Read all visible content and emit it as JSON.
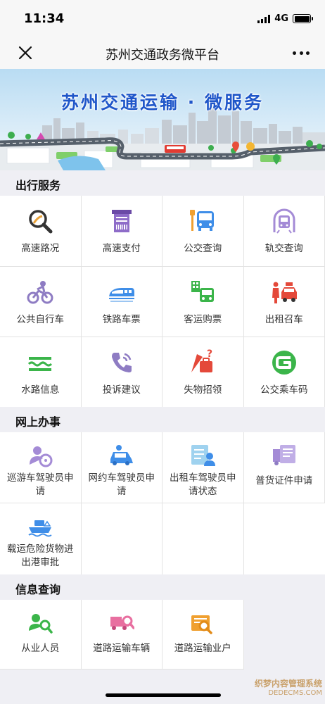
{
  "status_bar": {
    "time": "11:34",
    "network": "4G",
    "battery_level": 1.0
  },
  "nav": {
    "title": "苏州交通政务微平台",
    "close_icon": "close-icon",
    "more_icon": "more-icon"
  },
  "banner": {
    "title": "苏州交通运输 · 微服务"
  },
  "sections": [
    {
      "title": "出行服务",
      "items": [
        {
          "label": "高速路况",
          "icon": "highway-search-icon"
        },
        {
          "label": "高速支付",
          "icon": "toll-receipt-icon"
        },
        {
          "label": "公交查询",
          "icon": "bus-stop-icon"
        },
        {
          "label": "轨交查询",
          "icon": "metro-icon"
        },
        {
          "label": "公共自行车",
          "icon": "bicycle-icon"
        },
        {
          "label": "铁路车票",
          "icon": "train-icon"
        },
        {
          "label": "客运购票",
          "icon": "coach-ticket-icon"
        },
        {
          "label": "出租召车",
          "icon": "taxi-icon"
        },
        {
          "label": "水路信息",
          "icon": "waterway-icon"
        },
        {
          "label": "投诉建议",
          "icon": "phone-icon"
        },
        {
          "label": "失物招领",
          "icon": "lost-found-icon"
        },
        {
          "label": "公交乘车码",
          "icon": "qrcode-g-icon"
        }
      ]
    },
    {
      "title": "网上办事",
      "items": [
        {
          "label": "巡游车驾驶员申请",
          "icon": "driver-wheel-icon"
        },
        {
          "label": "网约车驾驶员申请",
          "icon": "ride-hailing-car-icon"
        },
        {
          "label": "出租车驾驶员申请状态",
          "icon": "driver-profile-icon"
        },
        {
          "label": "普货证件申请",
          "icon": "cargo-certificate-icon"
        },
        {
          "label": "载运危险货物进出港审批",
          "icon": "hazard-ship-icon"
        }
      ]
    },
    {
      "title": "信息查询",
      "items": [
        {
          "label": "从业人员",
          "icon": "staff-search-icon"
        },
        {
          "label": "道路运输车辆",
          "icon": "truck-search-icon"
        },
        {
          "label": "道路运输业户",
          "icon": "company-search-icon"
        }
      ]
    }
  ],
  "watermark": {
    "line1": "织梦内容管理系统",
    "line2": "DEDECMS.COM"
  },
  "colors": {
    "accent": "#1f56c9",
    "green": "#3bb54a",
    "purple": "#8e7cc3",
    "blue": "#3f8ee8",
    "orange": "#f0a030",
    "red": "#e4493a"
  }
}
